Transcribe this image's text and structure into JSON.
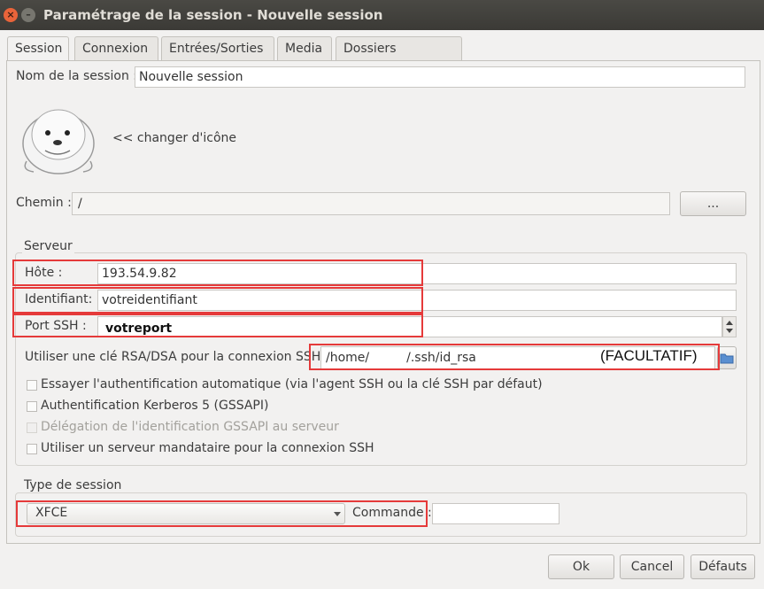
{
  "window": {
    "title": "Paramétrage de la session - Nouvelle session",
    "close_glyph": "×",
    "min_glyph": "–"
  },
  "tabs": [
    {
      "label": "Session"
    },
    {
      "label": "Connexion"
    },
    {
      "label": "Entrées/Sorties"
    },
    {
      "label": "Media"
    },
    {
      "label": "Dossiers partagés"
    }
  ],
  "session": {
    "name_label": "Nom de la session :",
    "name_value": "Nouvelle session",
    "change_icon_label": "<< changer d'icône",
    "path_label": "Chemin :",
    "path_value": "/",
    "browse_button": "..."
  },
  "server": {
    "group_title": "Serveur",
    "host_label": "Hôte :",
    "host_value": "193.54.9.82",
    "login_label": "Identifiant:",
    "login_value": "votreidentifiant",
    "port_label": "Port SSH :",
    "port_value": "votreport",
    "key_label": "Utiliser une clé RSA/DSA pour la connexion SSH:",
    "key_value_prefix": "/home/",
    "key_value_suffix": "/.ssh/id_rsa",
    "key_annotation": "(FACULTATIF)",
    "checkboxes": [
      {
        "label": "Essayer l'authentification automatique (via l'agent SSH ou la clé SSH par défaut)",
        "enabled": true,
        "checked": false
      },
      {
        "label": "Authentification Kerberos 5 (GSSAPI)",
        "enabled": true,
        "checked": false
      },
      {
        "label": "Délégation de l'identification GSSAPI au serveur",
        "enabled": false,
        "checked": false
      },
      {
        "label": "Utiliser un serveur mandataire pour la connexion SSH",
        "enabled": true,
        "checked": false
      }
    ]
  },
  "session_type": {
    "group_title": "Type de session",
    "selected": "XFCE",
    "command_label": "Commande :",
    "command_value": ""
  },
  "footer": {
    "ok": "Ok",
    "cancel": "Cancel",
    "defaults": "Défauts"
  },
  "colors": {
    "annotation_red": "#e53a3a",
    "titlebar": "#3b3a36",
    "close_button": "#e9643a"
  }
}
